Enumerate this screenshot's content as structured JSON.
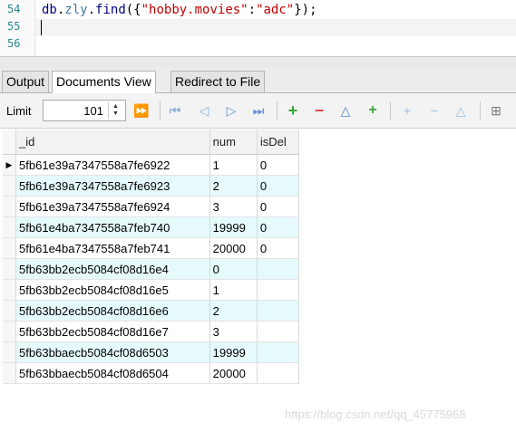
{
  "editor": {
    "line_numbers": [
      "54",
      "55",
      "56"
    ],
    "code": {
      "obj": "db",
      "dot1": ".",
      "coll": "zly",
      "dot2": ".",
      "method": "find",
      "open": "({",
      "key": "\"hobby.movies\"",
      "colon": ":",
      "value": "\"adc\"",
      "close": "});"
    }
  },
  "tabs": [
    "Output",
    "Documents View",
    "Redirect to File"
  ],
  "active_tab": "Documents View",
  "toolbar": {
    "limit_label": "Limit",
    "limit_value": "101"
  },
  "grid": {
    "columns": [
      "_id",
      "num",
      "isDel"
    ],
    "rows": [
      {
        "id": "5fb61e39a7347558a7fe6922",
        "num": "1",
        "isDel": "0"
      },
      {
        "id": "5fb61e39a7347558a7fe6923",
        "num": "2",
        "isDel": "0"
      },
      {
        "id": "5fb61e39a7347558a7fe6924",
        "num": "3",
        "isDel": "0"
      },
      {
        "id": "5fb61e4ba7347558a7feb740",
        "num": "19999",
        "isDel": "0"
      },
      {
        "id": "5fb61e4ba7347558a7feb741",
        "num": "20000",
        "isDel": "0"
      },
      {
        "id": "5fb63bb2ecb5084cf08d16e4",
        "num": "0",
        "isDel": ""
      },
      {
        "id": "5fb63bb2ecb5084cf08d16e5",
        "num": "1",
        "isDel": ""
      },
      {
        "id": "5fb63bb2ecb5084cf08d16e6",
        "num": "2",
        "isDel": ""
      },
      {
        "id": "5fb63bb2ecb5084cf08d16e7",
        "num": "3",
        "isDel": ""
      },
      {
        "id": "5fb63bbaecb5084cf08d6503",
        "num": "19999",
        "isDel": ""
      },
      {
        "id": "5fb63bbaecb5084cf08d6504",
        "num": "20000",
        "isDel": ""
      }
    ],
    "current_row_marker": "▶"
  },
  "watermark": "https://blog.csdn.net/qq_45775968",
  "colors": {
    "alt_row": "#e6fafc",
    "string": "#c00000",
    "identifier": "#3c78a0",
    "green_icon": "#3aa53a",
    "red_icon": "#d84a4a",
    "blue_icon": "#4a86d8"
  },
  "icons": [
    "step-forward-icon",
    "first-record-icon",
    "prev-record-icon",
    "next-record-icon",
    "last-record-icon",
    "add-record-icon",
    "delete-record-icon",
    "move-up-icon",
    "add-field-icon",
    "insert-icon",
    "remove-icon",
    "edit-icon",
    "grid-icon"
  ]
}
